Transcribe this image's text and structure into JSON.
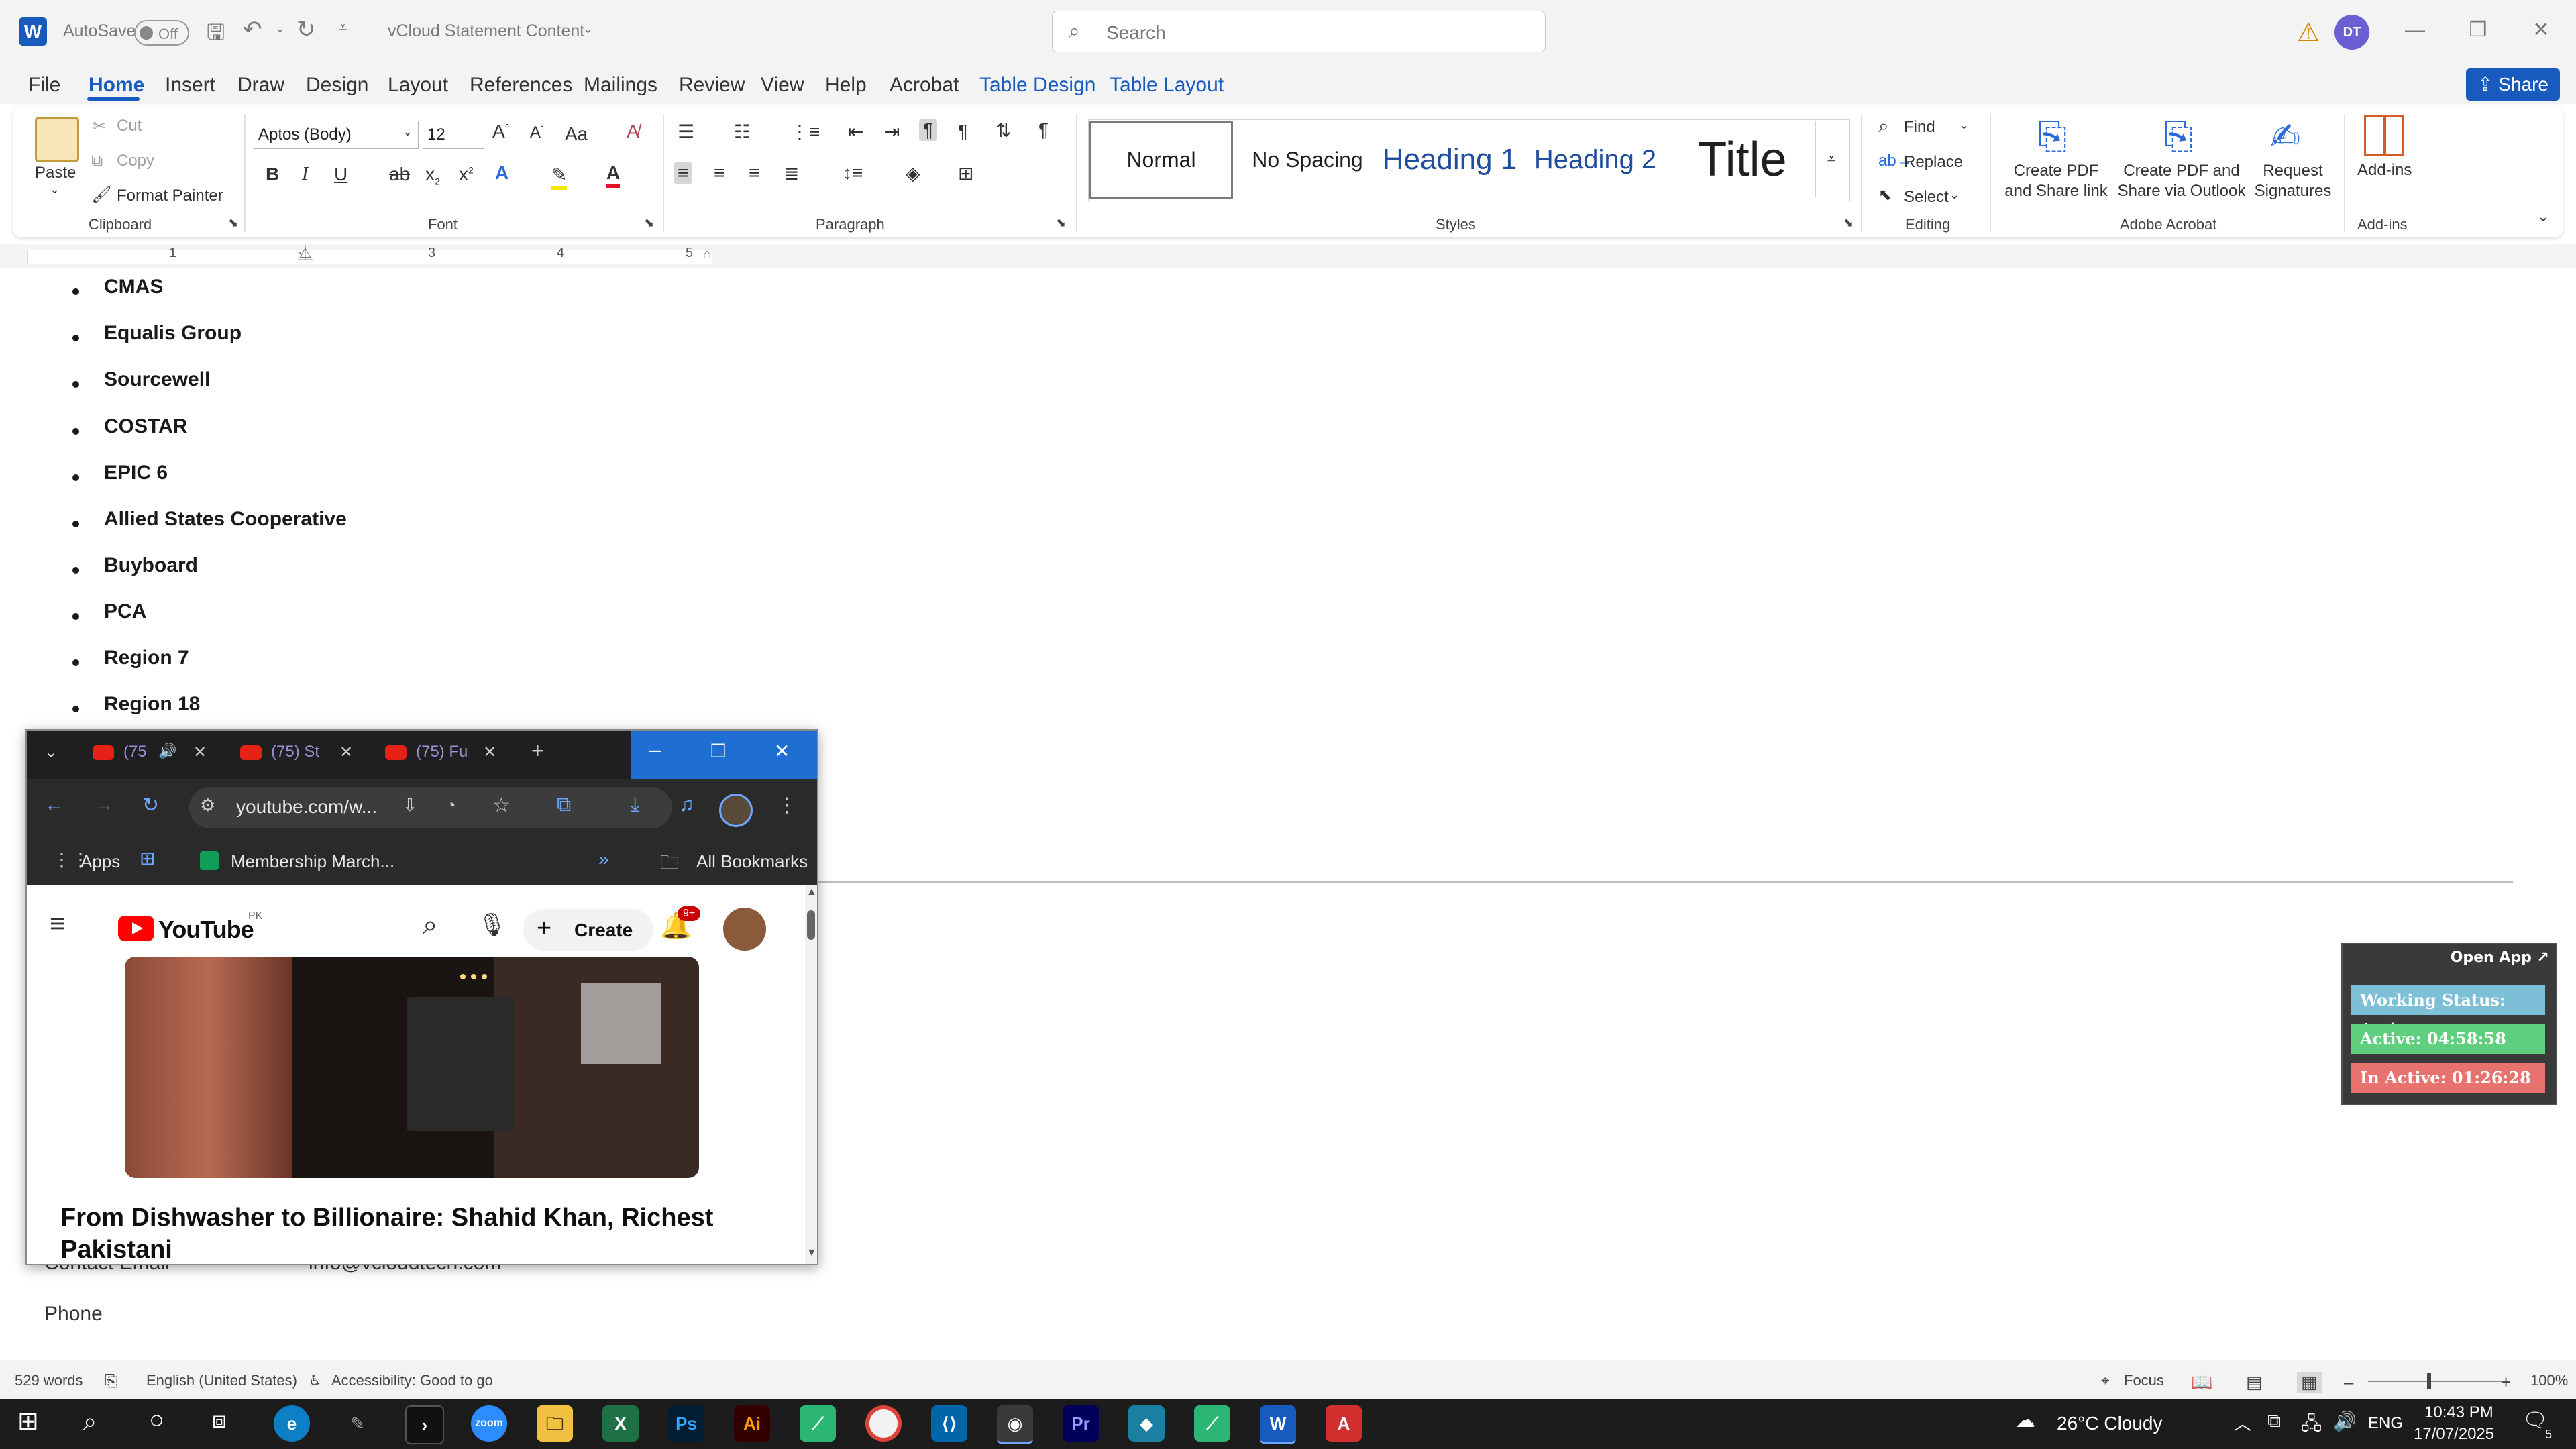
{
  "titlebar": {
    "autosave_label": "AutoSave",
    "autosave_state": "Off",
    "document_title": "vCloud Statement Content",
    "search_placeholder": "Search",
    "user_initials": "DT"
  },
  "menu": {
    "items": [
      "File",
      "Home",
      "Insert",
      "Draw",
      "Design",
      "Layout",
      "References",
      "Mailings",
      "Review",
      "View",
      "Help",
      "Acrobat"
    ],
    "contextual": [
      "Table Design",
      "Table Layout"
    ],
    "active": "Home",
    "share_label": "Share"
  },
  "ribbon": {
    "clipboard": {
      "paste": "Paste",
      "cut": "Cut",
      "copy": "Copy",
      "format_painter": "Format Painter",
      "group": "Clipboard"
    },
    "font": {
      "name": "Aptos (Body)",
      "size": "12",
      "group": "Font",
      "change_case": "Aa"
    },
    "paragraph": {
      "group": "Paragraph"
    },
    "styles": {
      "items": [
        "Normal",
        "No Spacing",
        "Heading 1",
        "Heading 2",
        "Title"
      ],
      "group": "Styles"
    },
    "editing": {
      "find": "Find",
      "replace": "Replace",
      "select": "Select",
      "group": "Editing"
    },
    "acrobat": {
      "create_share": "Create PDF\nand Share link",
      "create_outlook": "Create PDF and\nShare via Outlook",
      "request_sig": "Request\nSignatures",
      "group": "Adobe Acrobat"
    },
    "addins": {
      "label": "Add-ins",
      "group": "Add-ins"
    }
  },
  "ruler": {
    "numbers": [
      "1",
      "2",
      "3",
      "4",
      "5"
    ]
  },
  "document": {
    "bullets": [
      "CMAS",
      "Equalis Group",
      "Sourcewell",
      "COSTAR",
      "EPIC 6",
      "Allied States Cooperative",
      "Buyboard",
      "PCA",
      "Region 7",
      "Region 18"
    ],
    "contact_email_label": "Contact Email",
    "contact_email_value": "info@vcloudtech.com",
    "phone_label": "Phone"
  },
  "chrome": {
    "tabs": [
      "(75",
      "(75) St",
      "(75) Fu"
    ],
    "url": "youtube.com/w...",
    "bookmarks": {
      "apps": "Apps",
      "membership": "Membership March...",
      "all": "All Bookmarks"
    },
    "youtube": {
      "logo": "YouTube",
      "region": "PK",
      "create": "Create",
      "notifications": "9+",
      "video_title": "From Dishwasher to Billionaire: Shahid Khan, Richest Pakistani"
    }
  },
  "timer": {
    "open_app": "Open App ↗",
    "working_status": "Working Status: Active",
    "active": "Active: 04:58:58",
    "inactive": "In Active: 01:26:28",
    "colors": {
      "status": "#7cbfd6",
      "active": "#5fcf7e",
      "inactive": "#e8726d"
    }
  },
  "statusbar": {
    "words": "529 words",
    "language": "English (United States)",
    "accessibility": "Accessibility: Good to go",
    "focus": "Focus",
    "zoom": "100%"
  },
  "taskbar": {
    "weather": "26°C  Cloudy",
    "lang": "ENG",
    "time": "10:43 PM",
    "date": "17/07/2025",
    "notif_count": "5"
  }
}
